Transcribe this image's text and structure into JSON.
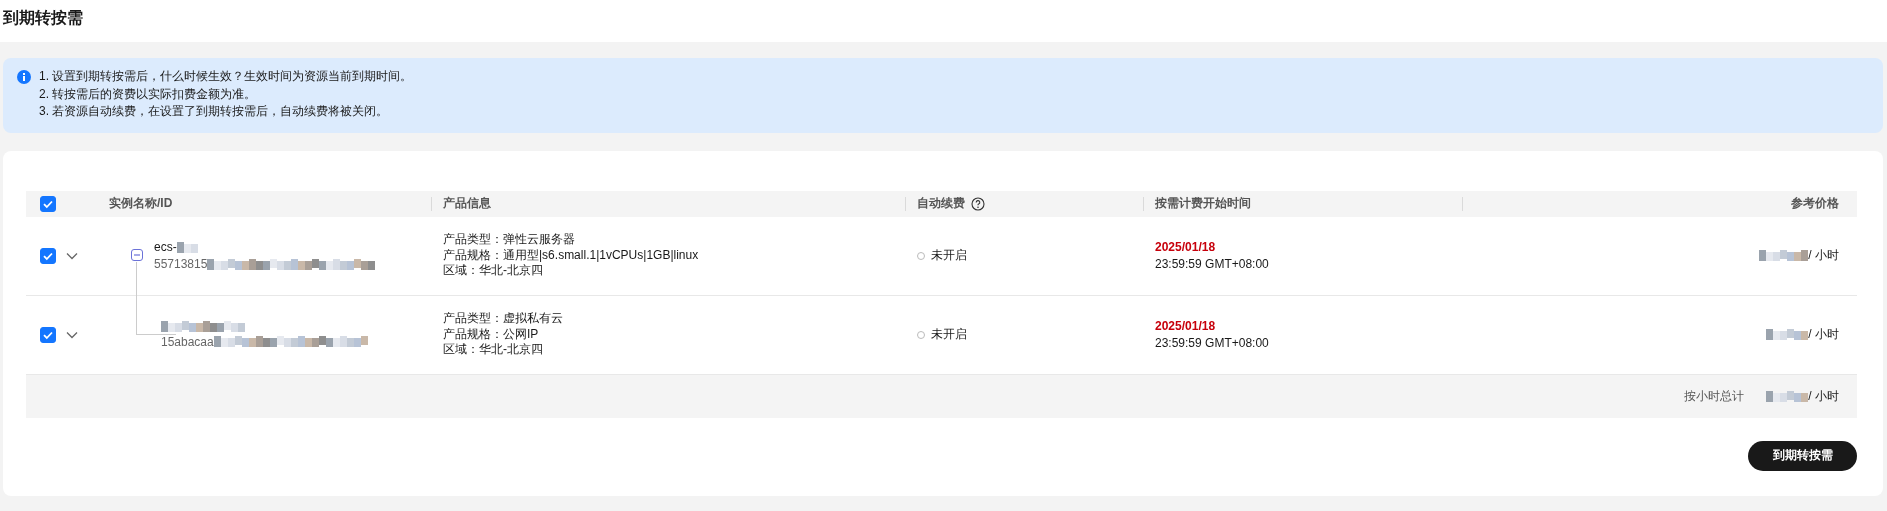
{
  "page_title": "到期转按需",
  "notice": {
    "lines": [
      "1. 设置到期转按需后，什么时候生效？生效时间为资源当前到期时间。",
      "2. 转按需后的资费以实际扣费金额为准。",
      "3. 若资源自动续费，在设置了到期转按需后，自动续费将被关闭。"
    ]
  },
  "table": {
    "select_all": {
      "checked": true
    },
    "columns": [
      "实例名称/ID",
      "产品信息",
      "自动续费",
      "按需计费开始时间",
      "参考价格"
    ],
    "rows": [
      {
        "kind": "parent",
        "expanded": true,
        "checked": true,
        "name": "ecs-",
        "id": "55713815",
        "product": [
          "产品类型：弹性云服务器",
          "产品规格：通用型|s6.small.1|1vCPUs|1GB|linux",
          "区域：华北-北京四"
        ],
        "auto_renew": {
          "on": false,
          "label": "未开启"
        },
        "start_date": "2025/01/18",
        "start_time": "23:59:59 GMT+08:00",
        "price": "/ 小时"
      },
      {
        "kind": "child",
        "checked": true,
        "id": "15abacaa",
        "product": [
          "产品类型：虚拟私有云",
          "产品规格：公网IP",
          "区域：华北-北京四"
        ],
        "auto_renew": {
          "on": false,
          "label": "未开启"
        },
        "start_date": "2025/01/18",
        "start_time": "23:59:59 GMT+08:00",
        "price": "/ 小时"
      }
    ],
    "total": {
      "label": "按小时总计",
      "value": "/ 小时"
    }
  },
  "submit_button": "到期转按需"
}
